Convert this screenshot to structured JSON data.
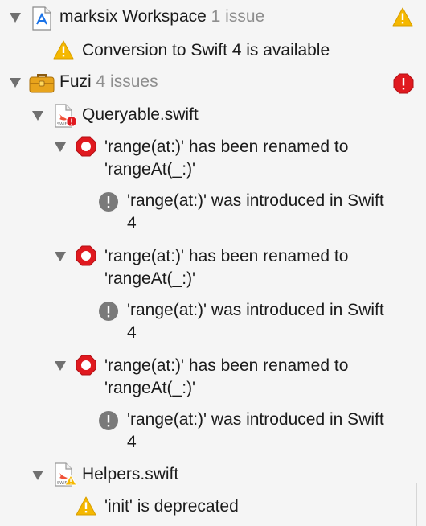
{
  "workspace": {
    "name": "marksix Workspace",
    "issue_count": "1 issue",
    "warning": "Conversion to Swift 4 is available"
  },
  "project": {
    "name": "Fuzi",
    "issue_count": "4 issues"
  },
  "files": [
    {
      "name": "Queryable.swift",
      "issues": [
        {
          "error": "'range(at:)' has been renamed to 'rangeAt(_:)'",
          "note": "'range(at:)' was introduced in Swift 4"
        },
        {
          "error": "'range(at:)' has been renamed to 'rangeAt(_:)'",
          "note": "'range(at:)' was introduced in Swift 4"
        },
        {
          "error": "'range(at:)' has been renamed to 'rangeAt(_:)'",
          "note": "'range(at:)' was introduced in Swift 4"
        }
      ]
    },
    {
      "name": "Helpers.swift",
      "warnings": [
        "'init' is deprecated"
      ]
    }
  ],
  "colors": {
    "warning": "#f5b800",
    "error": "#e0191f",
    "note": "#7a7a7a",
    "disclosure": "#707070"
  },
  "icons": [
    "disclosure-triangle-icon",
    "xcode-workspace-icon",
    "warning-icon",
    "toolbox-project-icon",
    "error-icon",
    "swift-file-icon",
    "note-icon"
  ]
}
